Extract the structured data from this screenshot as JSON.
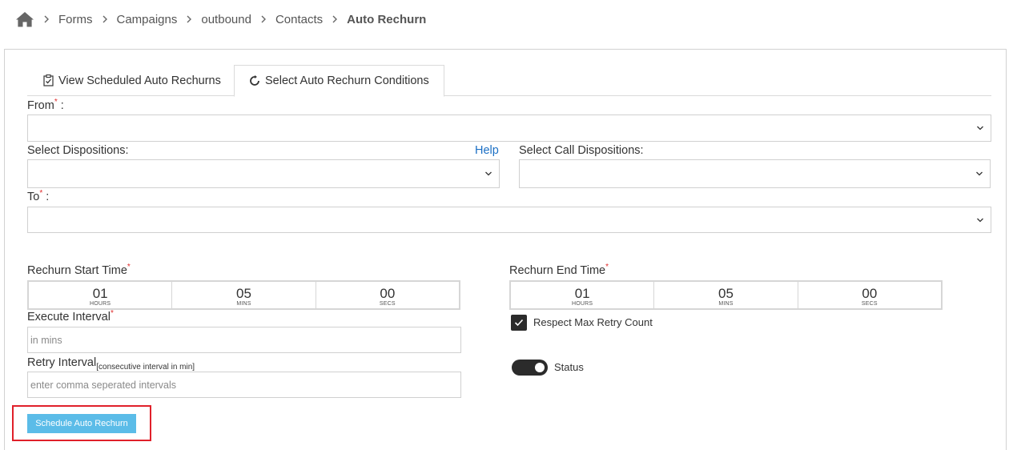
{
  "breadcrumb": {
    "items": [
      "Forms",
      "Campaigns",
      "outbound",
      "Contacts"
    ],
    "current": "Auto Rechurn"
  },
  "tabs": {
    "view_label": "View Scheduled Auto Rechurns",
    "select_label": "Select Auto Rechurn Conditions"
  },
  "form": {
    "from_label": "From",
    "from_colon": " :",
    "dispositions_label": "Select Dispositions:",
    "help_label": "Help",
    "call_dispositions_label": "Select Call Dispositions:",
    "to_label": "To",
    "to_colon": " :",
    "required_mark": "*",
    "start_time_label": "Rechurn Start Time",
    "end_time_label": "Rechurn End Time",
    "start_time": {
      "hours": "01",
      "mins": "05",
      "secs": "00"
    },
    "end_time": {
      "hours": "01",
      "mins": "05",
      "secs": "00"
    },
    "units": {
      "hours": "HOURS",
      "mins": "MINS",
      "secs": "SECS"
    },
    "execute_interval_label": "Execute Interval",
    "execute_interval_placeholder": "in mins",
    "retry_interval_label": "Retry Interval",
    "retry_interval_sublabel": "[consecutive interval in min]",
    "retry_interval_placeholder": "enter comma seperated intervals",
    "respect_max_retry_label": "Respect Max Retry Count",
    "respect_max_retry_checked": true,
    "status_label": "Status",
    "status_on": true,
    "schedule_button_label": "Schedule Auto Rechurn"
  },
  "colors": {
    "accent_button": "#5bbce8",
    "highlight_border": "#e0202a",
    "help_link": "#1b6fc4",
    "required": "#e02b2b"
  }
}
